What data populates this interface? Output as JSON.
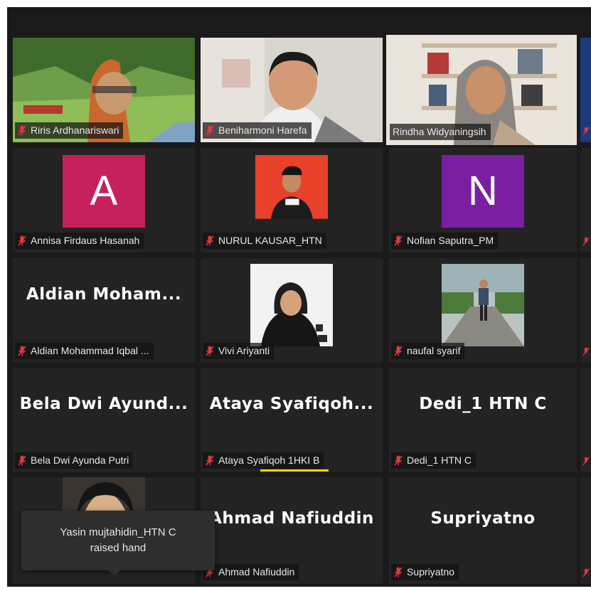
{
  "participants": [
    {
      "name": "Riris Ardhanariswari",
      "kind": "video"
    },
    {
      "name": "Beniharmoni Harefa",
      "kind": "video"
    },
    {
      "name": "Rindha Widyaningsih",
      "kind": "video",
      "active": true
    },
    {
      "name": "Annisa Firdaus Hasanah",
      "kind": "avatar",
      "initial": "A",
      "avatar_color": "#c7215d"
    },
    {
      "name": "NURUL KAUSAR_HTN",
      "kind": "photo",
      "photo_color": "#e8412b"
    },
    {
      "name": "Nofian Saputra_PM",
      "kind": "avatar",
      "initial": "N",
      "avatar_color": "#7a1fa2"
    },
    {
      "name": "Aldian Mohammad Iqbal ...",
      "kind": "text",
      "display": "Aldian  Moham..."
    },
    {
      "name": "Vivi Ariyanti",
      "kind": "photo",
      "photo_color": "#f2f2f2"
    },
    {
      "name": "naufal syarif",
      "kind": "photo",
      "photo_color": "#8a8a80"
    },
    {
      "name": "Bela Dwi Ayunda Putri",
      "kind": "text",
      "display": "Bela  Dwi  Ayund..."
    },
    {
      "name": "Ataya Syafiqoh 1HKI B",
      "kind": "text",
      "display": "Ataya  Syafiqoh...",
      "speaking": true
    },
    {
      "name": "Dedi_1 HTN C",
      "kind": "text",
      "display": "Dedi_1 HTN C"
    },
    {
      "name": "",
      "kind": "photo-partial"
    },
    {
      "name": "Ahmad Nafiuddin",
      "kind": "text",
      "display": "Ahmad Nafiuddin"
    },
    {
      "name": "Supriyatno",
      "kind": "text",
      "display": "Supriyatno"
    }
  ],
  "notification": {
    "line1": "Yasin mujtahidin_HTN C",
    "line2": "raised hand"
  },
  "colors": {
    "background": "#1a1a1a",
    "tile": "#232323",
    "active_border": "#c5dd3b",
    "speaking_bar": "#f5d700",
    "muted_icon": "#e0393e"
  },
  "icons": {
    "muted": "microphone-muted-icon"
  }
}
